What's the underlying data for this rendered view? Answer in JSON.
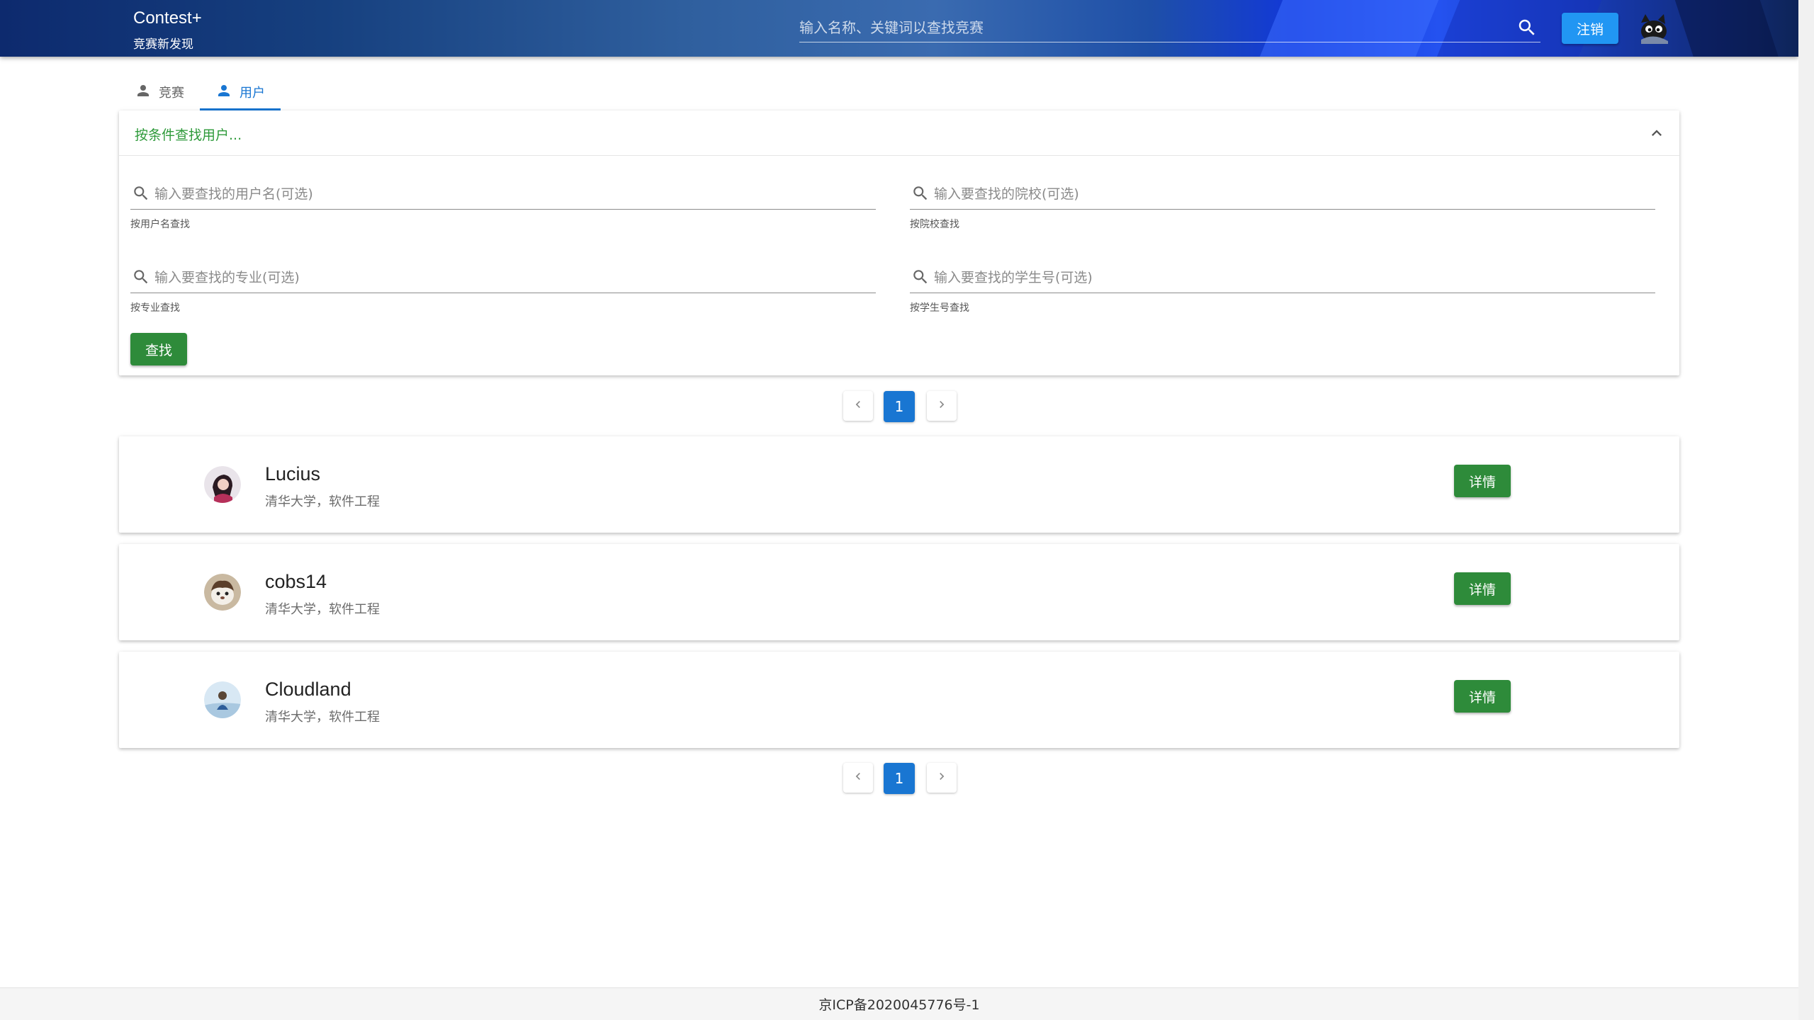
{
  "header": {
    "brand_title": "Contest+",
    "brand_subtitle": "竞赛新发现",
    "search_placeholder": "输入名称、关键词以查找竞赛",
    "logout_label": "注销"
  },
  "tabs": [
    {
      "label": "竞赛",
      "icon": "person-icon",
      "active": false
    },
    {
      "label": "用户",
      "icon": "person-icon",
      "active": true
    }
  ],
  "filter": {
    "title": "按条件查找用户...",
    "fields": [
      {
        "placeholder": "输入要查找的用户名(可选)",
        "hint": "按用户名查找",
        "value": ""
      },
      {
        "placeholder": "输入要查找的院校(可选)",
        "hint": "按院校查找",
        "value": ""
      },
      {
        "placeholder": "输入要查找的专业(可选)",
        "hint": "按专业查找",
        "value": ""
      },
      {
        "placeholder": "输入要查找的学生号(可选)",
        "hint": "按学生号查找",
        "value": ""
      }
    ],
    "find_label": "查找"
  },
  "pagination": {
    "current_page": "1"
  },
  "users": [
    {
      "name": "Lucius",
      "info": "清华大学，软件工程",
      "detail_label": "详情"
    },
    {
      "name": "cobs14",
      "info": "清华大学，软件工程",
      "detail_label": "详情"
    },
    {
      "name": "Cloudland",
      "info": "清华大学，软件工程",
      "detail_label": "详情"
    }
  ],
  "footer": {
    "text": "京ICP备2020045776号-1"
  },
  "colors": {
    "primary": "#1976d2",
    "green": "#2e8b3a",
    "logout_blue": "#2196f3",
    "filter_title": "#2e9a3a"
  }
}
